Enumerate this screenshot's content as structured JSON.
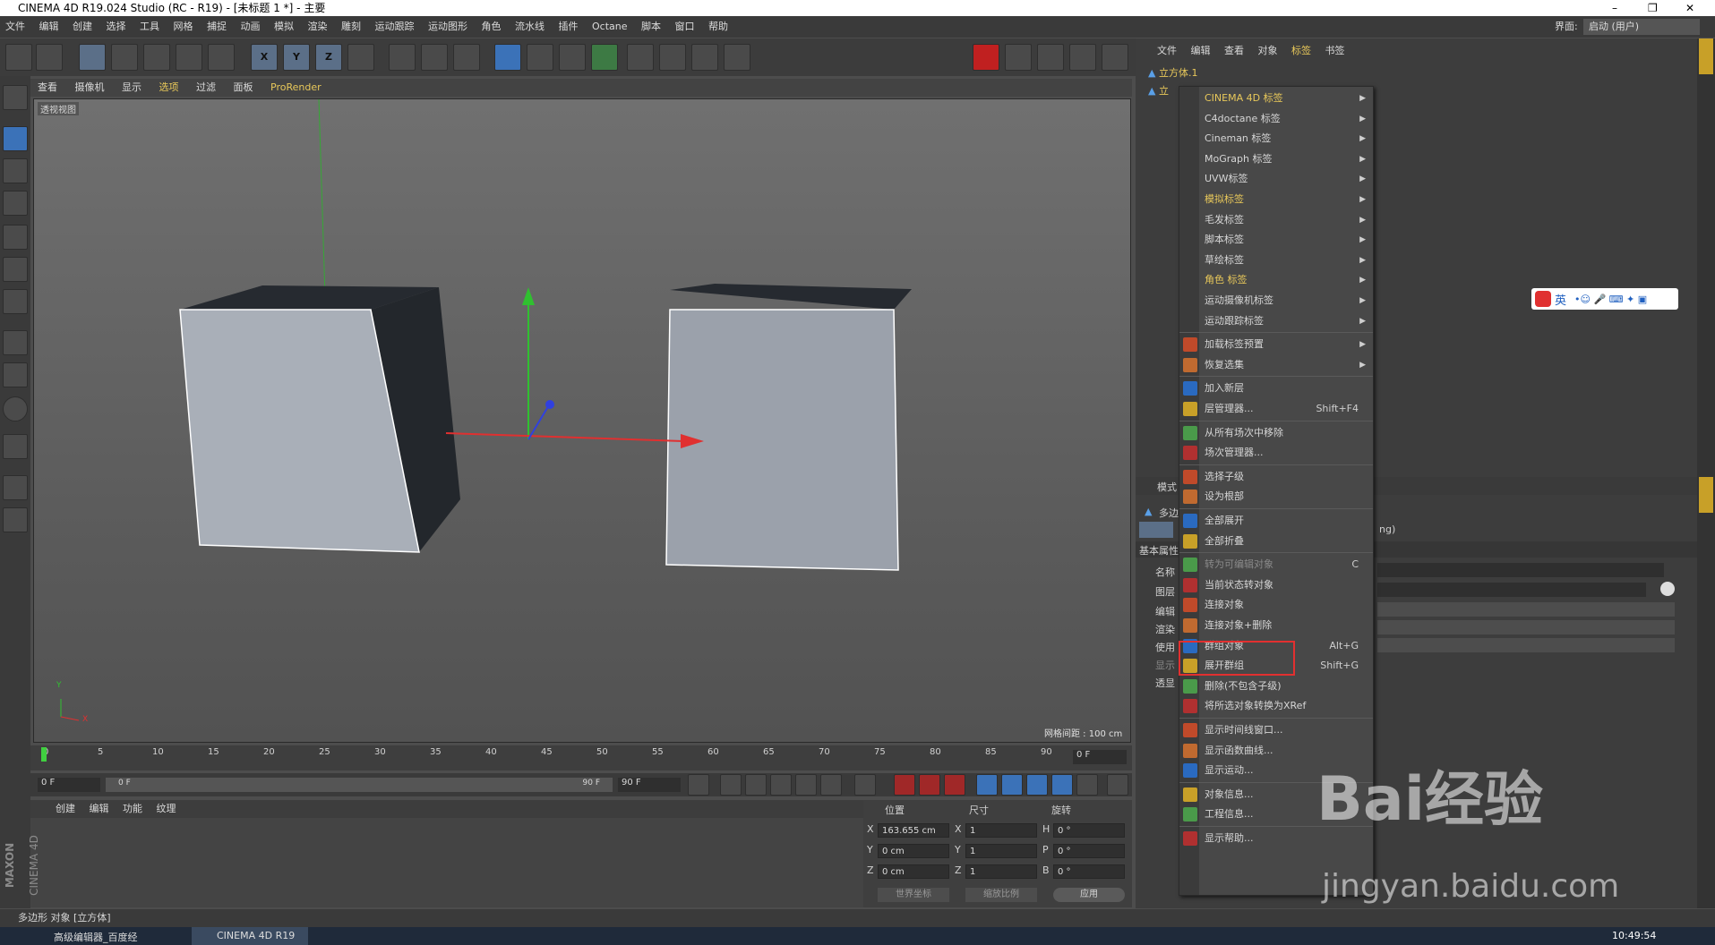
{
  "window": {
    "title": "CINEMA 4D R19.024 Studio (RC - R19) - [未标题 1 *] - 主要",
    "controls": [
      "–",
      "❐",
      "✕"
    ]
  },
  "menubar": {
    "items": [
      "文件",
      "编辑",
      "创建",
      "选择",
      "工具",
      "网格",
      "捕捉",
      "动画",
      "模拟",
      "渲染",
      "雕刻",
      "运动跟踪",
      "运动图形",
      "角色",
      "流水线",
      "插件",
      "Octane",
      "脚本",
      "窗口",
      "帮助"
    ],
    "layout_label": "界面:",
    "layout_value": "启动 (用户)"
  },
  "toolbar": {
    "axis_x": "X",
    "axis_y": "Y",
    "axis_z": "Z"
  },
  "viewport": {
    "menu": [
      "查看",
      "摄像机",
      "显示",
      "选项",
      "过滤",
      "面板",
      "ProRender"
    ],
    "label": "透视视图",
    "grid_spacing": "网格间距 : 100 cm",
    "axis_y": "Y",
    "axis_x": "X",
    "axis_z": "Z"
  },
  "timeline": {
    "ticks": [
      "0",
      "5",
      "10",
      "15",
      "20",
      "25",
      "30",
      "35",
      "40",
      "45",
      "50",
      "55",
      "60",
      "65",
      "70",
      "75",
      "80",
      "85",
      "90"
    ],
    "current": "0 F"
  },
  "transport": {
    "start": "0 F",
    "range_start": "0 F",
    "range_end": "90 F",
    "end": "90 F"
  },
  "material_panel": {
    "menu": [
      "创建",
      "编辑",
      "功能",
      "纹理"
    ],
    "brand1": "MAXON",
    "brand2": "CINEMA 4D"
  },
  "coord_panel": {
    "headers": [
      "位置",
      "尺寸",
      "旋转"
    ],
    "rows": [
      {
        "axis": "X",
        "pos": "163.655 cm",
        "size_axis": "X",
        "size": "1",
        "rot_axis": "H",
        "rot": "0 °"
      },
      {
        "axis": "Y",
        "pos": "0 cm",
        "size_axis": "Y",
        "size": "1",
        "rot_axis": "P",
        "rot": "0 °"
      },
      {
        "axis": "Z",
        "pos": "0 cm",
        "size_axis": "Z",
        "size": "1",
        "rot_axis": "B",
        "rot": "0 °"
      }
    ],
    "coord_mode": "世界坐标",
    "scale_mode": "缩放比例",
    "apply": "应用"
  },
  "object_manager": {
    "menu": [
      "文件",
      "编辑",
      "查看",
      "对象",
      "标签",
      "书签"
    ],
    "object1": "立方体.1",
    "object2": "立"
  },
  "attr_manager": {
    "mode": "模式",
    "obj": "多边",
    "basic": "基本属性",
    "name_lbl": "名称",
    "layer_lbl": "图层",
    "edit_lbl": "编辑",
    "render_lbl": "渲染",
    "use_lbl": "使用",
    "display_lbl": "显示",
    "through_lbl": "透显",
    "suffix": "ng)"
  },
  "context_menu": {
    "items": [
      {
        "label": "CINEMA 4D 标签",
        "arrow": "▶",
        "hl": true
      },
      {
        "label": "C4doctane 标签",
        "arrow": "▶"
      },
      {
        "label": "Cineman 标签",
        "arrow": "▶"
      },
      {
        "label": "MoGraph 标签",
        "arrow": "▶"
      },
      {
        "label": "UVW标签",
        "arrow": "▶"
      },
      {
        "label": "模拟标签",
        "arrow": "▶",
        "hl": true
      },
      {
        "label": "毛发标签",
        "arrow": "▶"
      },
      {
        "label": "脚本标签",
        "arrow": "▶"
      },
      {
        "label": "草绘标签",
        "arrow": "▶"
      },
      {
        "label": "角色 标签",
        "arrow": "▶",
        "hl": true
      },
      {
        "label": "运动摄像机标签",
        "arrow": "▶"
      },
      {
        "label": "运动跟踪标签",
        "arrow": "▶"
      },
      {
        "label": "加载标签预置",
        "arrow": "▶"
      },
      {
        "label": "恢复选集",
        "arrow": "▶"
      },
      {
        "label": "加入新层"
      },
      {
        "label": "层管理器...",
        "shortcut": "Shift+F4"
      },
      {
        "label": "从所有场次中移除"
      },
      {
        "label": "场次管理器..."
      },
      {
        "label": "选择子级"
      },
      {
        "label": "设为根部"
      },
      {
        "label": "全部展开"
      },
      {
        "label": "全部折叠"
      },
      {
        "label": "转为可编辑对象",
        "shortcut": "C",
        "dis": true
      },
      {
        "label": "当前状态转对象"
      },
      {
        "label": "连接对象"
      },
      {
        "label": "连接对象+删除"
      },
      {
        "label": "群组对象",
        "shortcut": "Alt+G"
      },
      {
        "label": "展开群组",
        "shortcut": "Shift+G"
      },
      {
        "label": "删除(不包含子级)"
      },
      {
        "label": "将所选对象转换为XRef"
      },
      {
        "label": "显示时间线窗口..."
      },
      {
        "label": "显示函数曲线..."
      },
      {
        "label": "显示运动..."
      },
      {
        "label": "对象信息..."
      },
      {
        "label": "工程信息..."
      },
      {
        "label": "显示帮助..."
      }
    ]
  },
  "ime": {
    "label": "英"
  },
  "statusbar": {
    "text": "多边形 对象 [立方体]"
  },
  "taskbar": {
    "app1": "高级编辑器_百度经",
    "app2": "CINEMA 4D R19",
    "clock": "10:49:54"
  },
  "watermark": {
    "text1": "Bai",
    "text2": "经验",
    "url": "jingyan.baidu.com"
  },
  "colors": {
    "accent": "#e8c85a",
    "highlight_box": "#e23030",
    "axis_x": "#e03030",
    "axis_y": "#30c030",
    "axis_z": "#3040e0"
  }
}
